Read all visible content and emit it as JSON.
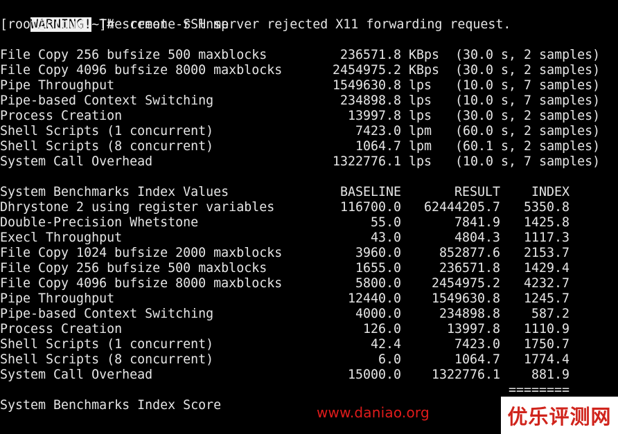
{
  "header": {
    "warning_badge": "WARNING!",
    "warning_message": " The remote SSH server rejected X11 forwarding request.",
    "prompt": "[root@cloud ~]# screen -r lnmp"
  },
  "raw_results": [
    {
      "name": "File Copy 256 bufsize 500 maxblocks",
      "value": "236571.8",
      "unit": "KBps",
      "detail": "(30.0 s, 2 samples)"
    },
    {
      "name": "File Copy 4096 bufsize 8000 maxblocks",
      "value": "2454975.2",
      "unit": "KBps",
      "detail": "(30.0 s, 2 samples)"
    },
    {
      "name": "Pipe Throughput",
      "value": "1549630.8",
      "unit": "lps",
      "detail": "(10.0 s, 7 samples)"
    },
    {
      "name": "Pipe-based Context Switching",
      "value": "234898.8",
      "unit": "lps",
      "detail": "(10.0 s, 7 samples)"
    },
    {
      "name": "Process Creation",
      "value": "13997.8",
      "unit": "lps",
      "detail": "(30.0 s, 2 samples)"
    },
    {
      "name": "Shell Scripts (1 concurrent)",
      "value": "7423.0",
      "unit": "lpm",
      "detail": "(60.0 s, 2 samples)"
    },
    {
      "name": "Shell Scripts (8 concurrent)",
      "value": "1064.7",
      "unit": "lpm",
      "detail": "(60.1 s, 2 samples)"
    },
    {
      "name": "System Call Overhead",
      "value": "1322776.1",
      "unit": "lps",
      "detail": "(10.0 s, 7 samples)"
    }
  ],
  "index_table": {
    "title": "System Benchmarks Index Values",
    "col_baseline": "BASELINE",
    "col_result": "RESULT",
    "col_index": "INDEX",
    "rows": [
      {
        "name": "Dhrystone 2 using register variables",
        "baseline": "116700.0",
        "result": "62444205.7",
        "index": "5350.8"
      },
      {
        "name": "Double-Precision Whetstone",
        "baseline": "55.0",
        "result": "7841.9",
        "index": "1425.8"
      },
      {
        "name": "Execl Throughput",
        "baseline": "43.0",
        "result": "4804.3",
        "index": "1117.3"
      },
      {
        "name": "File Copy 1024 bufsize 2000 maxblocks",
        "baseline": "3960.0",
        "result": "852877.6",
        "index": "2153.7"
      },
      {
        "name": "File Copy 256 bufsize 500 maxblocks",
        "baseline": "1655.0",
        "result": "236571.8",
        "index": "1429.4"
      },
      {
        "name": "File Copy 4096 bufsize 8000 maxblocks",
        "baseline": "5800.0",
        "result": "2454975.2",
        "index": "4232.7"
      },
      {
        "name": "Pipe Throughput",
        "baseline": "12440.0",
        "result": "1549630.8",
        "index": "1245.7"
      },
      {
        "name": "Pipe-based Context Switching",
        "baseline": "4000.0",
        "result": "234898.8",
        "index": "587.2"
      },
      {
        "name": "Process Creation",
        "baseline": "126.0",
        "result": "13997.8",
        "index": "1110.9"
      },
      {
        "name": "Shell Scripts (1 concurrent)",
        "baseline": "42.4",
        "result": "7423.0",
        "index": "1750.7"
      },
      {
        "name": "Shell Scripts (8 concurrent)",
        "baseline": "6.0",
        "result": "1064.7",
        "index": "1774.4"
      },
      {
        "name": "System Call Overhead",
        "baseline": "15000.0",
        "result": "1322776.1",
        "index": "881.9"
      }
    ],
    "separator": "========",
    "score_label": "System Benchmarks Index Score"
  },
  "watermark": "www.daniao.org",
  "logo": "优乐评测网",
  "colors": {
    "background": "#000000",
    "text": "#e6e6e6",
    "watermark": "#e01b1b",
    "logo": "#d0241c"
  }
}
